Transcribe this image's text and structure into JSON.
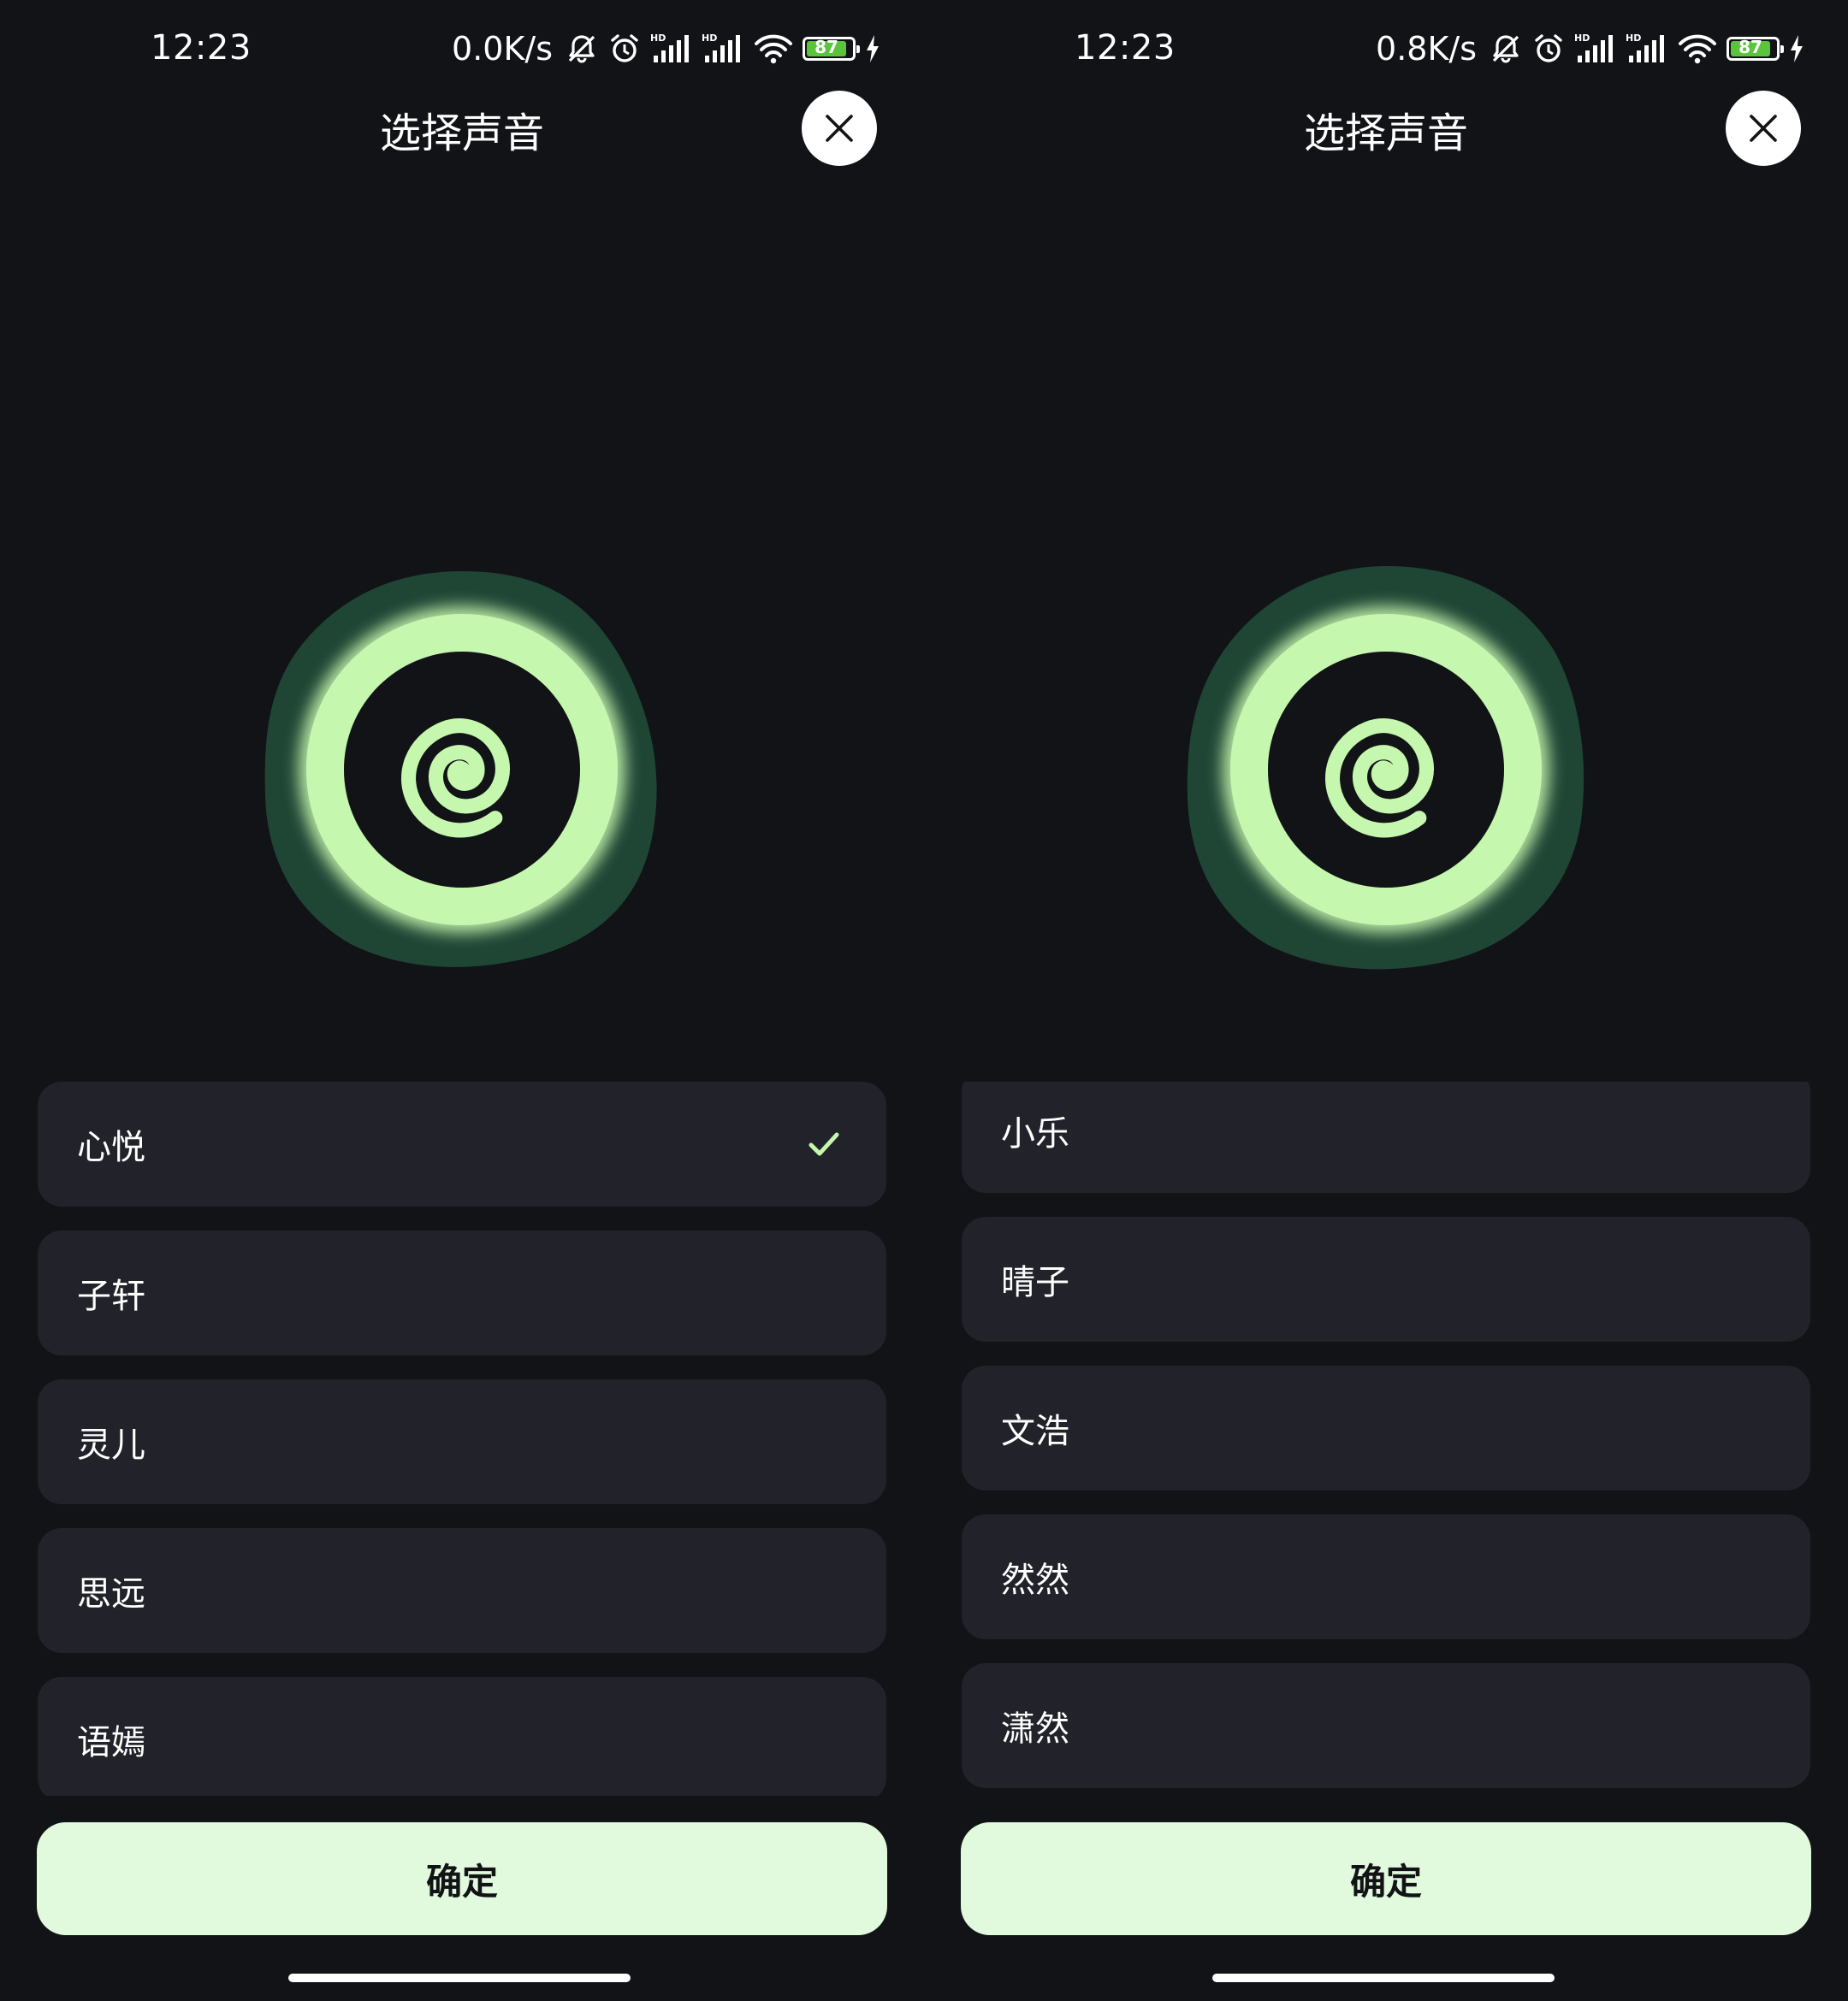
{
  "colors": {
    "background": "#121317",
    "card": "#22232a",
    "accent_green": "#c6f7ae",
    "glow": "#1f4535",
    "confirm_bg": "#e1f9dc",
    "battery_green": "#5ac43c"
  },
  "screens": [
    {
      "status_bar": {
        "time": "12:23",
        "net_speed": "0.0K/s",
        "battery_level": "87",
        "icons": [
          "mute-icon",
          "alarm-icon",
          "hd-signal-icon",
          "hd-signal-icon",
          "wifi-icon",
          "battery-icon",
          "charging-icon"
        ]
      },
      "header": {
        "title": "选择声音",
        "close_icon": "close-icon"
      },
      "visual_icon": "spiral-voice-icon",
      "voices": [
        {
          "label": "心悦",
          "selected": true
        },
        {
          "label": "子轩",
          "selected": false
        },
        {
          "label": "灵儿",
          "selected": false
        },
        {
          "label": "思远",
          "selected": false
        },
        {
          "label": "语嫣",
          "selected": false
        }
      ],
      "confirm_label": "确定"
    },
    {
      "status_bar": {
        "time": "12:23",
        "net_speed": "0.8K/s",
        "battery_level": "87",
        "icons": [
          "mute-icon",
          "alarm-icon",
          "hd-signal-icon",
          "hd-signal-icon",
          "wifi-icon",
          "battery-icon",
          "charging-icon"
        ]
      },
      "header": {
        "title": "选择声音",
        "close_icon": "close-icon"
      },
      "visual_icon": "spiral-voice-icon",
      "voices": [
        {
          "label": "小乐",
          "selected": false
        },
        {
          "label": "晴子",
          "selected": false
        },
        {
          "label": "文浩",
          "selected": false
        },
        {
          "label": "然然",
          "selected": false
        },
        {
          "label": "潇然",
          "selected": false
        }
      ],
      "confirm_label": "确定"
    }
  ]
}
